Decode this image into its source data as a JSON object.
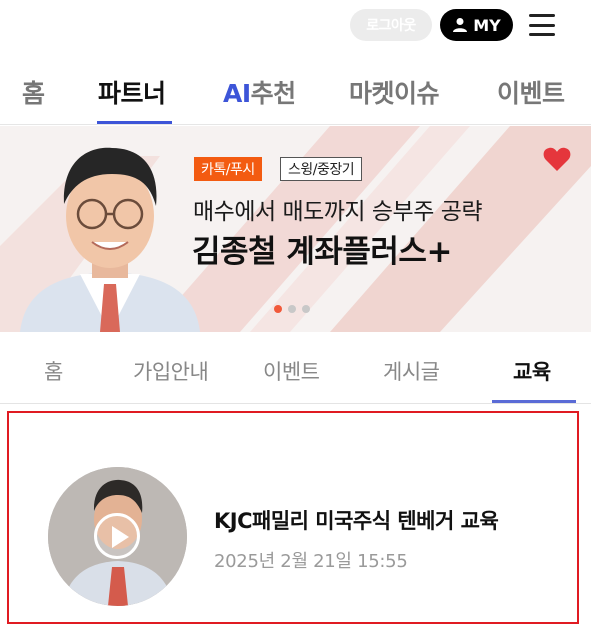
{
  "header": {
    "logout_label": "로그아웃",
    "my_label": "MY"
  },
  "main_tabs": [
    {
      "label": "홈"
    },
    {
      "label": "파트너"
    },
    {
      "label_ai": "AI",
      "label": "추천"
    },
    {
      "label": "마켓이슈"
    },
    {
      "label": "이벤트"
    }
  ],
  "main_tabs_active": "파트너",
  "banner": {
    "tag1": "카톡/푸시",
    "tag2": "스윙/중장기",
    "subtitle": "매수에서 매도까지 승부주 공략",
    "title": "김종철 계좌플러스+",
    "slide_count": 3,
    "active_slide": 1,
    "favorited": true
  },
  "sub_tabs": [
    {
      "label": "홈"
    },
    {
      "label": "가입안내"
    },
    {
      "label": "이벤트"
    },
    {
      "label": "게시글"
    },
    {
      "label": "교육"
    }
  ],
  "sub_tabs_active": "교육",
  "content": {
    "title": "KJC패밀리 미국주식 텐베거 교육",
    "date": "2025년 2월 21일 15:55"
  },
  "colors": {
    "accent_blue": "#3d55d8",
    "tag_orange": "#f35b11",
    "heart_red": "#e5363c",
    "highlight_border": "#e01b22"
  }
}
